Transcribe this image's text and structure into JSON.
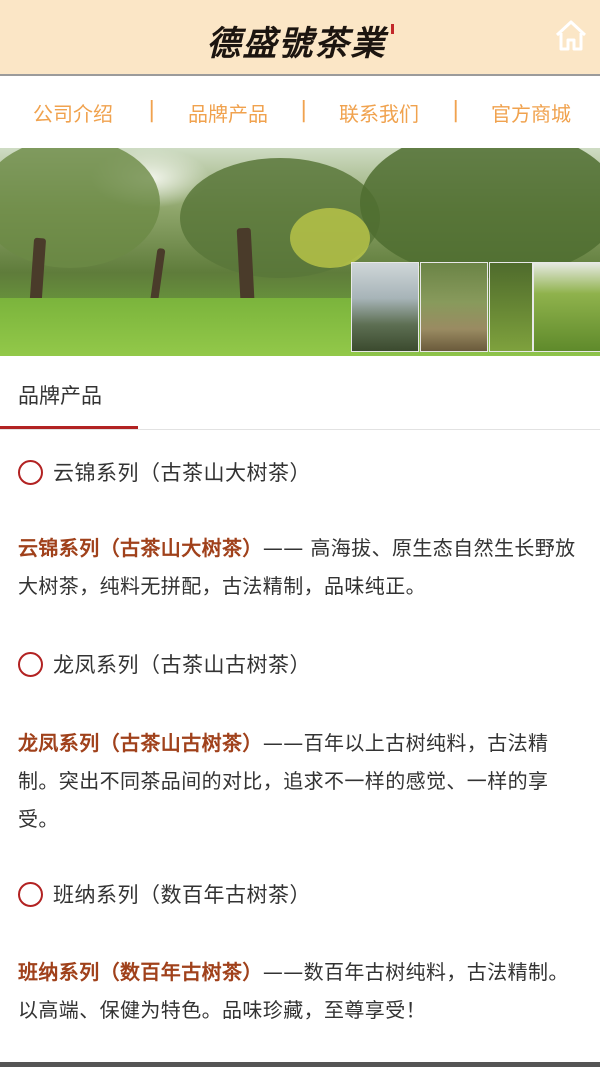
{
  "header": {
    "logo_text": "德盛號茶業",
    "home_icon": "home-icon"
  },
  "nav": {
    "items": [
      {
        "label": "公司介绍"
      },
      {
        "label": "品牌产品"
      },
      {
        "label": "联系我们"
      },
      {
        "label": "官方商城"
      }
    ],
    "separator": "|"
  },
  "section": {
    "title": "品牌产品"
  },
  "products": [
    {
      "series": "云锦系列（古茶山大树茶）",
      "desc_name": "云锦系列（古茶山大树茶）",
      "desc_text": "—— 高海拔、原生态自然生长野放大树茶，纯料无拼配，古法精制，品味纯正。"
    },
    {
      "series": "龙凤系列（古茶山古树茶）",
      "desc_name": "龙凤系列（古茶山古树茶）",
      "desc_text": "——百年以上古树纯料，古法精制。突出不同茶品间的对比，追求不一样的感觉、一样的享受。"
    },
    {
      "series": "班纳系列（数百年古树茶）",
      "desc_name": "班纳系列（数百年古树茶）",
      "desc_text": "——数百年古树纯料，古法精制。以高端、保健为特色。品味珍藏，至尊享受！"
    }
  ],
  "colors": {
    "header_bg": "#fbe6c6",
    "nav_text": "#f0a24e",
    "accent_red": "#b22222",
    "highlight_brown": "#a0411b"
  }
}
